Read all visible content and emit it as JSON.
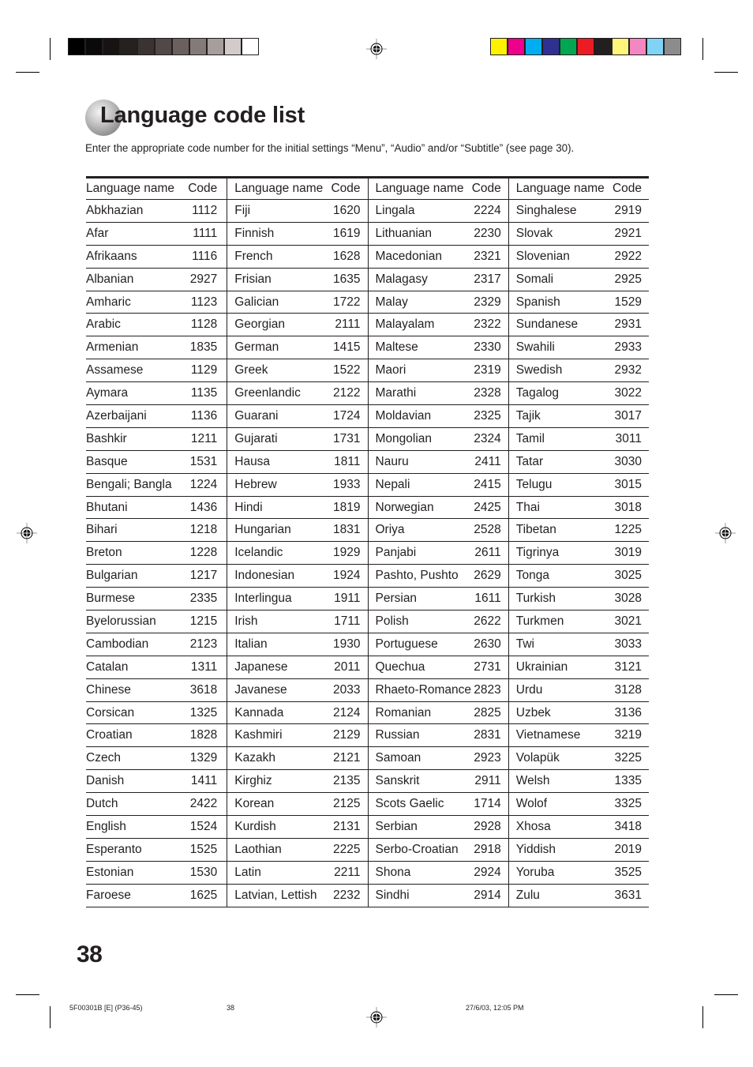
{
  "color_bars": {
    "grayscale": [
      "#000000",
      "#0b0a0a",
      "#171313",
      "#252120",
      "#3b3331",
      "#524847",
      "#6b605e",
      "#847b79",
      "#a69e9c",
      "#d2cbca",
      "#ffffff"
    ],
    "process": [
      "#fff200",
      "#ec008c",
      "#00aeef",
      "#2e3192",
      "#00a651",
      "#ed1c24",
      "#231f20",
      "#fff57a",
      "#f287c2",
      "#7fd4f5",
      "#8c8c8c"
    ]
  },
  "title": "Language code list",
  "intro": "Enter the appropriate code number for the initial settings “Menu”, “Audio” and/or “Subtitle” (see page 30).",
  "table": {
    "header": {
      "name": "Language name",
      "code": "Code"
    },
    "columns": [
      [
        {
          "name": "Abkhazian",
          "code": "1112"
        },
        {
          "name": "Afar",
          "code": "1111"
        },
        {
          "name": "Afrikaans",
          "code": "1116"
        },
        {
          "name": "Albanian",
          "code": "2927"
        },
        {
          "name": "Amharic",
          "code": "1123"
        },
        {
          "name": "Arabic",
          "code": "1128"
        },
        {
          "name": "Armenian",
          "code": "1835"
        },
        {
          "name": "Assamese",
          "code": "1129"
        },
        {
          "name": "Aymara",
          "code": "1135"
        },
        {
          "name": "Azerbaijani",
          "code": "1136"
        },
        {
          "name": "Bashkir",
          "code": "1211"
        },
        {
          "name": "Basque",
          "code": "1531"
        },
        {
          "name": "Bengali; Bangla",
          "code": "1224"
        },
        {
          "name": "Bhutani",
          "code": "1436"
        },
        {
          "name": "Bihari",
          "code": "1218"
        },
        {
          "name": "Breton",
          "code": "1228"
        },
        {
          "name": "Bulgarian",
          "code": "1217"
        },
        {
          "name": "Burmese",
          "code": "2335"
        },
        {
          "name": "Byelorussian",
          "code": "1215"
        },
        {
          "name": "Cambodian",
          "code": "2123"
        },
        {
          "name": "Catalan",
          "code": "1311"
        },
        {
          "name": "Chinese",
          "code": "3618"
        },
        {
          "name": "Corsican",
          "code": "1325"
        },
        {
          "name": "Croatian",
          "code": "1828"
        },
        {
          "name": "Czech",
          "code": "1329"
        },
        {
          "name": "Danish",
          "code": "1411"
        },
        {
          "name": "Dutch",
          "code": "2422"
        },
        {
          "name": "English",
          "code": "1524"
        },
        {
          "name": "Esperanto",
          "code": "1525"
        },
        {
          "name": "Estonian",
          "code": "1530"
        },
        {
          "name": "Faroese",
          "code": "1625"
        }
      ],
      [
        {
          "name": "Fiji",
          "code": "1620"
        },
        {
          "name": "Finnish",
          "code": "1619"
        },
        {
          "name": "French",
          "code": "1628"
        },
        {
          "name": "Frisian",
          "code": "1635"
        },
        {
          "name": "Galician",
          "code": "1722"
        },
        {
          "name": "Georgian",
          "code": "2111"
        },
        {
          "name": "German",
          "code": "1415"
        },
        {
          "name": "Greek",
          "code": "1522"
        },
        {
          "name": "Greenlandic",
          "code": "2122"
        },
        {
          "name": "Guarani",
          "code": "1724"
        },
        {
          "name": "Gujarati",
          "code": "1731"
        },
        {
          "name": "Hausa",
          "code": "1811"
        },
        {
          "name": "Hebrew",
          "code": "1933"
        },
        {
          "name": "Hindi",
          "code": "1819"
        },
        {
          "name": "Hungarian",
          "code": "1831"
        },
        {
          "name": "Icelandic",
          "code": "1929"
        },
        {
          "name": "Indonesian",
          "code": "1924"
        },
        {
          "name": "Interlingua",
          "code": "1911"
        },
        {
          "name": "Irish",
          "code": "1711"
        },
        {
          "name": "Italian",
          "code": "1930"
        },
        {
          "name": "Japanese",
          "code": "2011"
        },
        {
          "name": "Javanese",
          "code": "2033"
        },
        {
          "name": "Kannada",
          "code": "2124"
        },
        {
          "name": "Kashmiri",
          "code": "2129"
        },
        {
          "name": "Kazakh",
          "code": "2121"
        },
        {
          "name": "Kirghiz",
          "code": "2135"
        },
        {
          "name": "Korean",
          "code": "2125"
        },
        {
          "name": "Kurdish",
          "code": "2131"
        },
        {
          "name": "Laothian",
          "code": "2225"
        },
        {
          "name": "Latin",
          "code": "2211"
        },
        {
          "name": "Latvian, Lettish",
          "code": "2232"
        }
      ],
      [
        {
          "name": "Lingala",
          "code": "2224"
        },
        {
          "name": "Lithuanian",
          "code": "2230"
        },
        {
          "name": "Macedonian",
          "code": "2321"
        },
        {
          "name": "Malagasy",
          "code": "2317"
        },
        {
          "name": "Malay",
          "code": "2329"
        },
        {
          "name": "Malayalam",
          "code": "2322"
        },
        {
          "name": "Maltese",
          "code": "2330"
        },
        {
          "name": "Maori",
          "code": "2319"
        },
        {
          "name": "Marathi",
          "code": "2328"
        },
        {
          "name": "Moldavian",
          "code": "2325"
        },
        {
          "name": "Mongolian",
          "code": "2324"
        },
        {
          "name": "Nauru",
          "code": "2411"
        },
        {
          "name": "Nepali",
          "code": "2415"
        },
        {
          "name": "Norwegian",
          "code": "2425"
        },
        {
          "name": "Oriya",
          "code": "2528"
        },
        {
          "name": "Panjabi",
          "code": "2611"
        },
        {
          "name": "Pashto, Pushto",
          "code": "2629"
        },
        {
          "name": "Persian",
          "code": "1611"
        },
        {
          "name": "Polish",
          "code": "2622"
        },
        {
          "name": "Portuguese",
          "code": "2630"
        },
        {
          "name": "Quechua",
          "code": "2731"
        },
        {
          "name": "Rhaeto-Romance",
          "code": "2823"
        },
        {
          "name": "Romanian",
          "code": "2825"
        },
        {
          "name": "Russian",
          "code": "2831"
        },
        {
          "name": "Samoan",
          "code": "2923"
        },
        {
          "name": "Sanskrit",
          "code": "2911"
        },
        {
          "name": "Scots Gaelic",
          "code": "1714"
        },
        {
          "name": "Serbian",
          "code": "2928"
        },
        {
          "name": "Serbo-Croatian",
          "code": "2918"
        },
        {
          "name": "Shona",
          "code": "2924"
        },
        {
          "name": "Sindhi",
          "code": "2914"
        }
      ],
      [
        {
          "name": "Singhalese",
          "code": "2919"
        },
        {
          "name": "Slovak",
          "code": "2921"
        },
        {
          "name": "Slovenian",
          "code": "2922"
        },
        {
          "name": "Somali",
          "code": "2925"
        },
        {
          "name": "Spanish",
          "code": "1529"
        },
        {
          "name": "Sundanese",
          "code": "2931"
        },
        {
          "name": "Swahili",
          "code": "2933"
        },
        {
          "name": "Swedish",
          "code": "2932"
        },
        {
          "name": "Tagalog",
          "code": "3022"
        },
        {
          "name": "Tajik",
          "code": "3017"
        },
        {
          "name": "Tamil",
          "code": "3011"
        },
        {
          "name": "Tatar",
          "code": "3030"
        },
        {
          "name": "Telugu",
          "code": "3015"
        },
        {
          "name": "Thai",
          "code": "3018"
        },
        {
          "name": "Tibetan",
          "code": "1225"
        },
        {
          "name": "Tigrinya",
          "code": "3019"
        },
        {
          "name": "Tonga",
          "code": "3025"
        },
        {
          "name": "Turkish",
          "code": "3028"
        },
        {
          "name": "Turkmen",
          "code": "3021"
        },
        {
          "name": "Twi",
          "code": "3033"
        },
        {
          "name": "Ukrainian",
          "code": "3121"
        },
        {
          "name": "Urdu",
          "code": "3128"
        },
        {
          "name": "Uzbek",
          "code": "3136"
        },
        {
          "name": "Vietnamese",
          "code": "3219"
        },
        {
          "name": "Volapük",
          "code": "3225"
        },
        {
          "name": "Welsh",
          "code": "1335"
        },
        {
          "name": "Wolof",
          "code": "3325"
        },
        {
          "name": "Xhosa",
          "code": "3418"
        },
        {
          "name": "Yiddish",
          "code": "2019"
        },
        {
          "name": "Yoruba",
          "code": "3525"
        },
        {
          "name": "Zulu",
          "code": "3631"
        }
      ]
    ]
  },
  "page_number": "38",
  "footer": {
    "job_id": "5F00301B [E] (P36-45)",
    "page": "38",
    "timestamp": "27/6/03, 12:05 PM"
  }
}
